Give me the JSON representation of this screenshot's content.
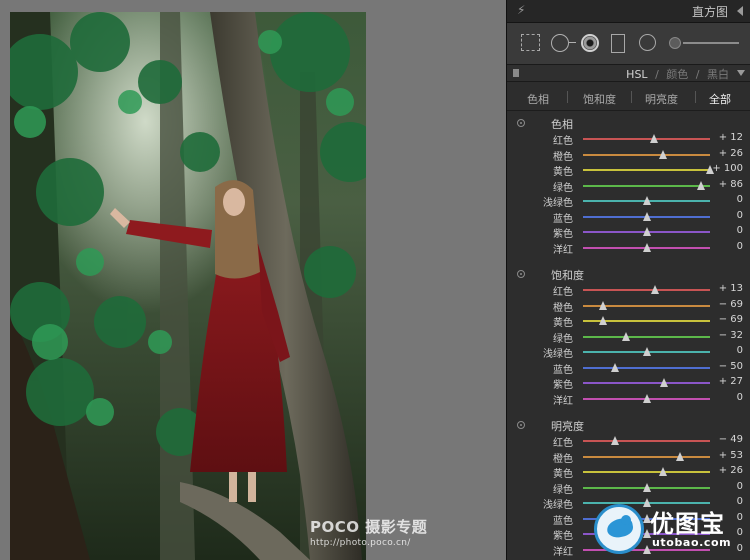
{
  "photo": {
    "watermark_brand": "POCO 摄影专题",
    "watermark_url": "http://photo.poco.cn/"
  },
  "panel": {
    "histogram_title": "直方图",
    "hsl_tabs": [
      "HSL",
      "/",
      "颜色",
      "/",
      "黑白"
    ],
    "active_tab": "HSL",
    "subtabs": [
      "色相",
      "饱和度",
      "明亮度",
      "全部"
    ],
    "active_subtab": "全部",
    "tools": [
      "crop-overlay-icon",
      "spot-removal-icon",
      "red-eye-icon",
      "graduated-filter-icon",
      "radial-filter-icon",
      "adjustment-brush-icon"
    ]
  },
  "sections": [
    {
      "title": "色相",
      "rows": [
        {
          "label": "红色",
          "value": 12,
          "display": "+ 12",
          "color": "#c85454"
        },
        {
          "label": "橙色",
          "value": 26,
          "display": "+ 26",
          "color": "#c98a3f"
        },
        {
          "label": "黄色",
          "value": 100,
          "display": "+ 100",
          "color": "#c8c23c"
        },
        {
          "label": "绿色",
          "value": 86,
          "display": "+ 86",
          "color": "#5cb84a"
        },
        {
          "label": "浅绿色",
          "value": 0,
          "display": "0",
          "color": "#4bb3ad"
        },
        {
          "label": "蓝色",
          "value": 0,
          "display": "0",
          "color": "#4f6ed1"
        },
        {
          "label": "紫色",
          "value": 0,
          "display": "0",
          "color": "#8b56c9"
        },
        {
          "label": "洋红",
          "value": 0,
          "display": "0",
          "color": "#c24fb0"
        }
      ]
    },
    {
      "title": "饱和度",
      "rows": [
        {
          "label": "红色",
          "value": 13,
          "display": "+ 13",
          "color": "#c85454"
        },
        {
          "label": "橙色",
          "value": -69,
          "display": "− 69",
          "color": "#c98a3f"
        },
        {
          "label": "黄色",
          "value": -69,
          "display": "− 69",
          "color": "#c8c23c"
        },
        {
          "label": "绿色",
          "value": -32,
          "display": "− 32",
          "color": "#5cb84a"
        },
        {
          "label": "浅绿色",
          "value": 0,
          "display": "0",
          "color": "#4bb3ad"
        },
        {
          "label": "蓝色",
          "value": -50,
          "display": "− 50",
          "color": "#4f6ed1"
        },
        {
          "label": "紫色",
          "value": 27,
          "display": "+ 27",
          "color": "#8b56c9"
        },
        {
          "label": "洋红",
          "value": 0,
          "display": "0",
          "color": "#c24fb0"
        }
      ]
    },
    {
      "title": "明亮度",
      "rows": [
        {
          "label": "红色",
          "value": -49,
          "display": "− 49",
          "color": "#c85454"
        },
        {
          "label": "橙色",
          "value": 53,
          "display": "+ 53",
          "color": "#c98a3f"
        },
        {
          "label": "黄色",
          "value": 26,
          "display": "+ 26",
          "color": "#c8c23c"
        },
        {
          "label": "绿色",
          "value": 0,
          "display": "0",
          "color": "#5cb84a"
        },
        {
          "label": "浅绿色",
          "value": 0,
          "display": "0",
          "color": "#4bb3ad"
        },
        {
          "label": "蓝色",
          "value": 0,
          "display": "0",
          "color": "#4f6ed1"
        },
        {
          "label": "紫色",
          "value": 0,
          "display": "0",
          "color": "#8b56c9"
        },
        {
          "label": "洋红",
          "value": 0,
          "display": "0",
          "color": "#c24fb0"
        }
      ]
    }
  ],
  "logo": {
    "name": "优图宝",
    "url": "utobao.com"
  }
}
